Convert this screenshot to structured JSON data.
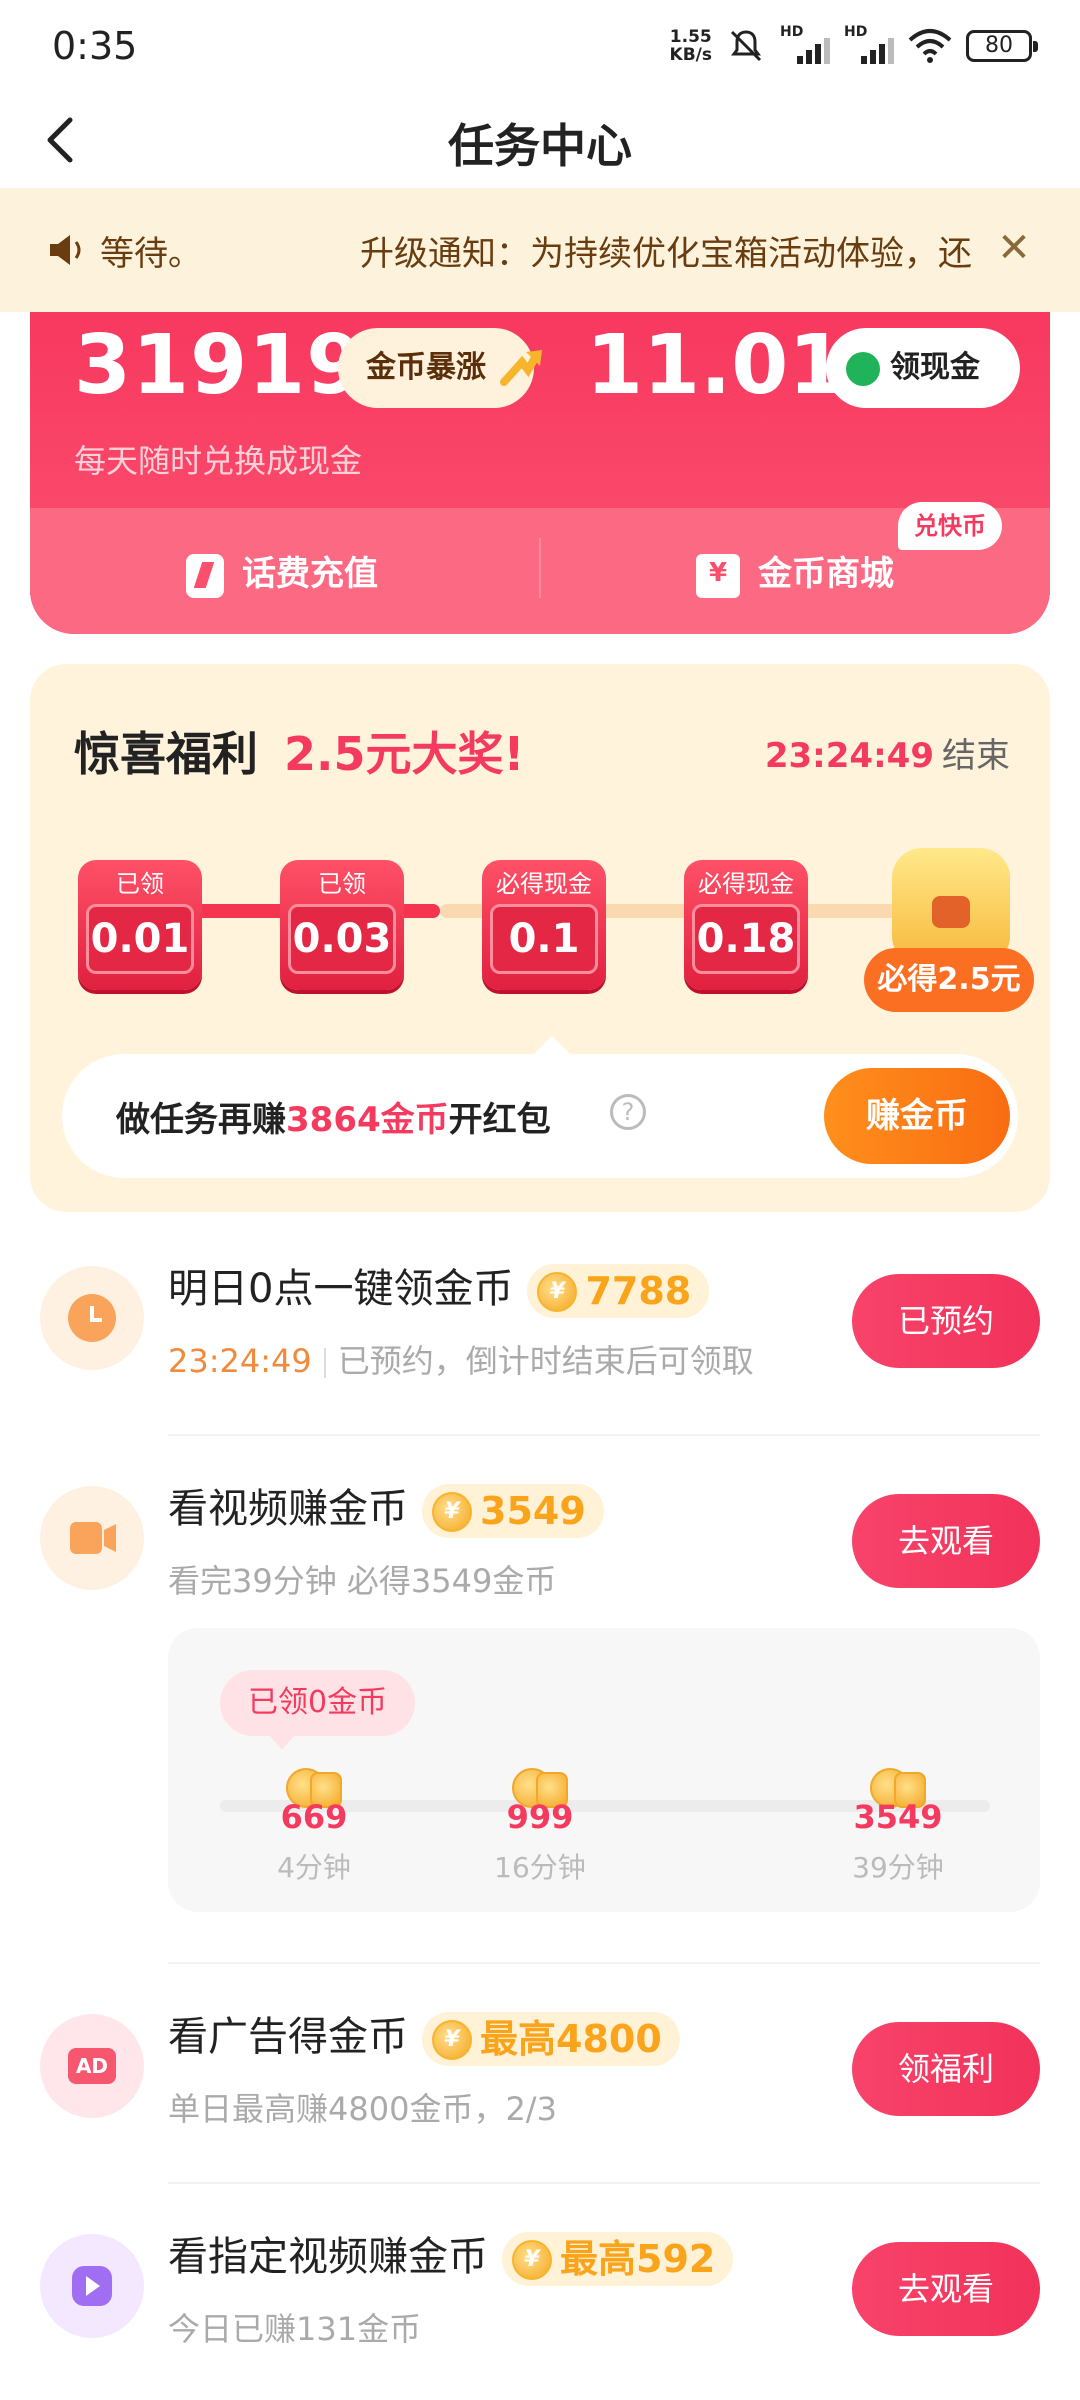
{
  "status_bar": {
    "time": "0:35",
    "net_speed_value": "1.55",
    "net_speed_unit": "KB/s",
    "signal1_label": "HD",
    "signal2_label": "HD",
    "battery": "80"
  },
  "nav": {
    "title": "任务中心"
  },
  "notice": {
    "left_text": "等待。",
    "scroll_text": "升级通知：为持续优化宝箱活动体验，还",
    "close": "✕"
  },
  "wallet": {
    "coins": "31919",
    "coin_rise_label": "金币暴涨",
    "cash": "11.01",
    "cash_button": "领现金",
    "subtitle": "每天随时兑换成现金",
    "recharge_label": "话费充值",
    "mall_label": "金币商城",
    "mall_badge": "兑快币"
  },
  "surprise": {
    "title_black": "惊喜福利",
    "title_red": "2.5元大奖!",
    "timer": "23:24:49",
    "timer_suffix": "结束",
    "stages": [
      {
        "label": "已领",
        "value": "0.01"
      },
      {
        "label": "已领",
        "value": "0.03"
      },
      {
        "label": "必得现金",
        "value": "0.1"
      },
      {
        "label": "必得现金",
        "value": "0.18"
      }
    ],
    "final_reward": "必得2.5元",
    "task_prefix": "做任务再赚",
    "task_highlight": "3864金币",
    "task_suffix": "开红包",
    "help_icon": "?",
    "earn_button": "赚金币"
  },
  "tasks": [
    {
      "title": "明日0点一键领金币",
      "coins": "7788",
      "sub_time": "23:24:49",
      "sub": "已预约，倒计时结束后可领取",
      "button": "已预约"
    },
    {
      "title": "看视频赚金币",
      "coins": "3549",
      "sub": "看完39分钟 必得3549金币",
      "button": "去观看"
    },
    {
      "title": "看广告得金币",
      "coins": "最高4800",
      "sub": "单日最高赚4800金币，2/3",
      "button": "领福利",
      "icon_text": "AD"
    },
    {
      "title": "看指定视频赚金币",
      "coins": "最高592",
      "sub": "今日已赚131金币",
      "button": "去观看"
    }
  ],
  "video_progress": {
    "got_label": "已领0金币",
    "milestones": [
      {
        "amount": "669",
        "time": "4分钟"
      },
      {
        "amount": "999",
        "time": "16分钟"
      },
      {
        "amount": "3549",
        "time": "39分钟"
      }
    ]
  },
  "colors": {
    "brand_red": "#f53a5f",
    "coin_orange": "#f9a41a",
    "notice_bg": "#fdf3dc"
  }
}
